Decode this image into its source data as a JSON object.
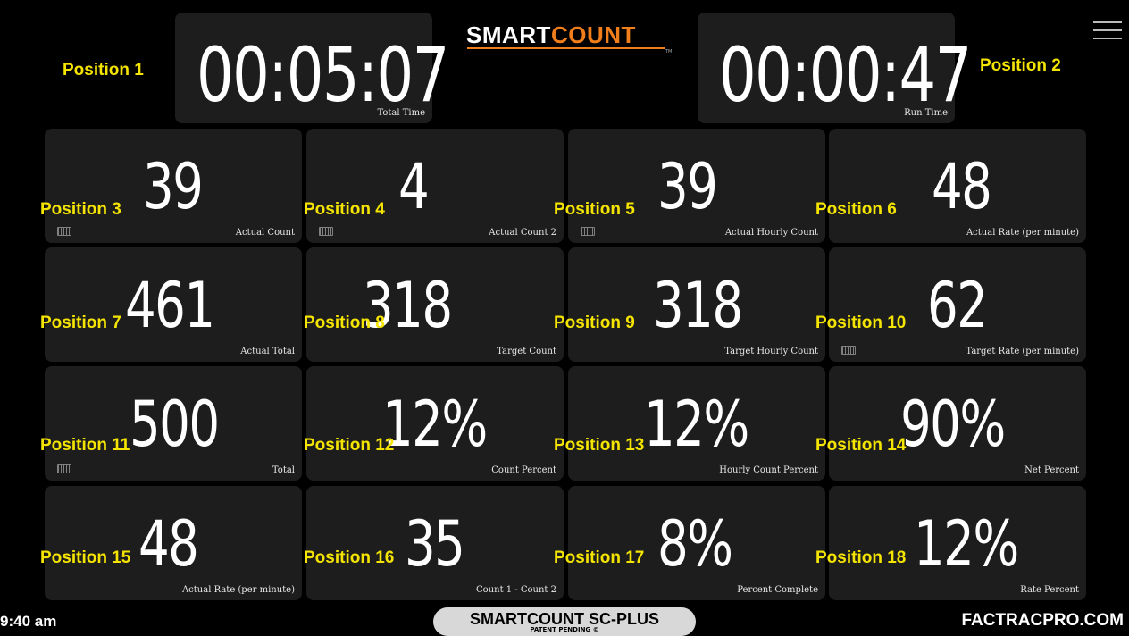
{
  "brand": {
    "logo_part1": "SMART",
    "logo_part2": "COUNT",
    "logo_tm": "TM",
    "accent_color": "#f07e1b"
  },
  "menu_icon": "hamburger-menu-icon",
  "timers": [
    {
      "position": "Position 1",
      "value": "00:05:07",
      "caption": "Total Time"
    },
    {
      "position": "Position 2",
      "value": "00:00:47",
      "caption": "Run Time"
    }
  ],
  "cells": [
    {
      "position": "Position 3",
      "value": "39",
      "caption": "Actual Count",
      "keyboard": true
    },
    {
      "position": "Position 4",
      "value": "4",
      "caption": "Actual Count 2",
      "keyboard": true
    },
    {
      "position": "Position 5",
      "value": "39",
      "caption": "Actual Hourly Count",
      "keyboard": true
    },
    {
      "position": "Position 6",
      "value": "48",
      "caption": "Actual Rate (per minute)",
      "keyboard": false
    },
    {
      "position": "Position 7",
      "value": "461",
      "caption": "Actual Total",
      "keyboard": false
    },
    {
      "position": "Position 8",
      "value": "318",
      "caption": "Target Count",
      "keyboard": false
    },
    {
      "position": "Position 9",
      "value": "318",
      "caption": "Target Hourly Count",
      "keyboard": false
    },
    {
      "position": "Position 10",
      "value": "62",
      "caption": "Target Rate (per minute)",
      "keyboard": true
    },
    {
      "position": "Position 11",
      "value": "500",
      "caption": "Total",
      "keyboard": true
    },
    {
      "position": "Position 12",
      "value": "12%",
      "caption": "Count Percent",
      "keyboard": false
    },
    {
      "position": "Position 13",
      "value": "12%",
      "caption": "Hourly Count Percent",
      "keyboard": false
    },
    {
      "position": "Position 14",
      "value": "90%",
      "caption": "Net Percent",
      "keyboard": false
    },
    {
      "position": "Position 15",
      "value": "48",
      "caption": "Actual Rate (per minute)",
      "keyboard": false
    },
    {
      "position": "Position 16",
      "value": "35",
      "caption": "Count 1 - Count 2",
      "keyboard": false
    },
    {
      "position": "Position 17",
      "value": "8%",
      "caption": "Percent Complete",
      "keyboard": false
    },
    {
      "position": "Position 18",
      "value": "12%",
      "caption": "Rate Percent",
      "keyboard": false
    }
  ],
  "footer": {
    "time": "9:40 am",
    "product": "SMARTCOUNT SC-PLUS",
    "patent": "PATENT PENDING ©",
    "website": "FACTRACPRO.COM"
  }
}
